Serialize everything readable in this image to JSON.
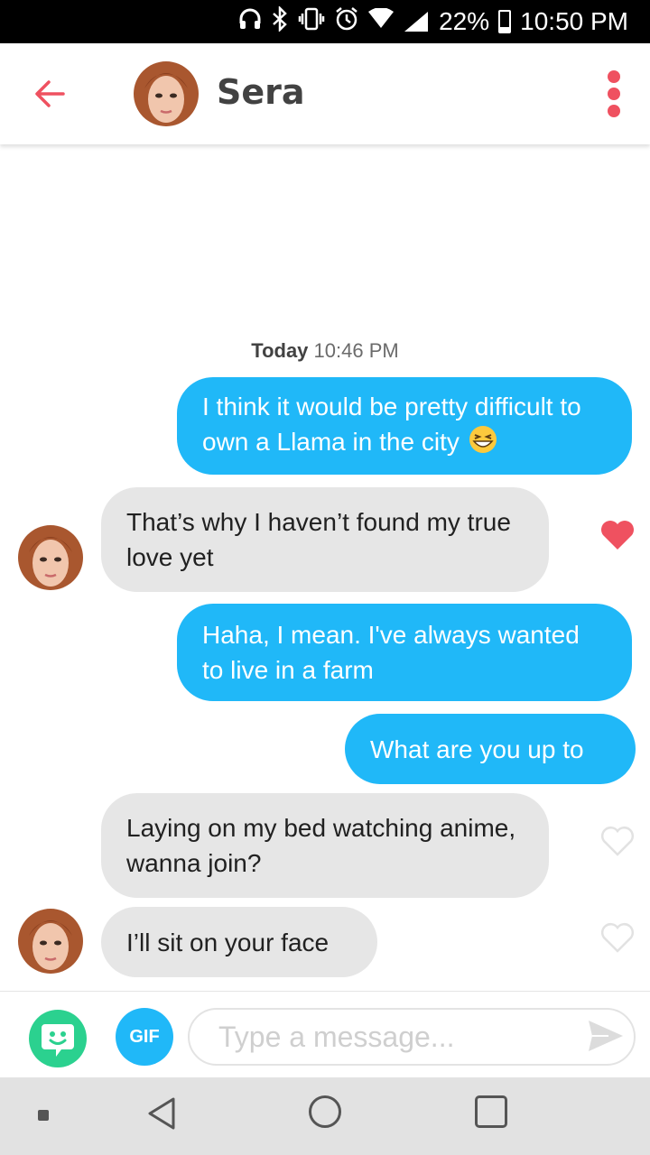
{
  "status_bar": {
    "battery": "22%",
    "time": "10:50 PM",
    "battery_level": 0.22
  },
  "header": {
    "contact_name": "Sera",
    "accent_color": "#ef5160"
  },
  "conversation": {
    "timestamp_day": "Today",
    "timestamp_time": "10:46 PM",
    "messages": [
      {
        "from": "me",
        "text": "I think it would be pretty difficult to own a Llama in the city",
        "emoji": "grinning-squinting-face"
      },
      {
        "from": "them",
        "text": "That’s why I haven’t found my true love yet",
        "liked": true
      },
      {
        "from": "me",
        "text": "Haha, I mean. I've always wanted to live in a farm"
      },
      {
        "from": "me",
        "text": "What are you up to"
      },
      {
        "from": "them",
        "text": "Laying on my bed watching anime, wanna join?",
        "liked": false
      },
      {
        "from": "them",
        "text": "I’ll sit on your face",
        "liked": false
      }
    ]
  },
  "composer": {
    "gif_label": "GIF",
    "placeholder": "Type a message..."
  },
  "colors": {
    "outgoing_bubble": "#20b8f8",
    "incoming_bubble": "#e6e6e6",
    "sticker_button": "#2bd18f",
    "heart": "#ef5160"
  }
}
